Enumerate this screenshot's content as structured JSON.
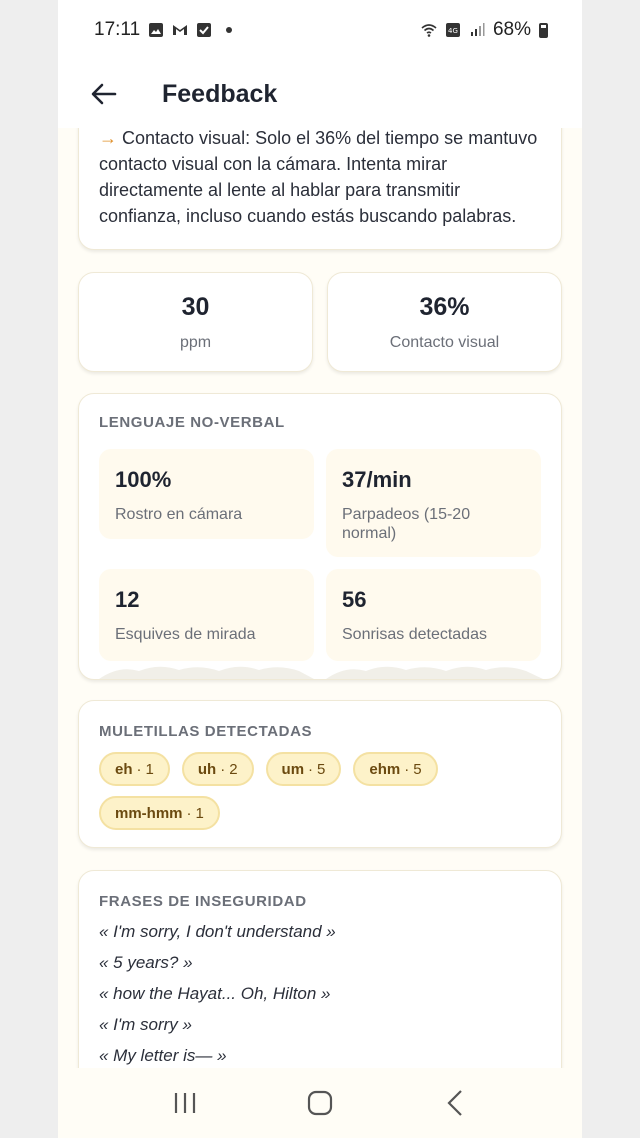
{
  "status_bar": {
    "time": "17:11",
    "battery": "68%",
    "icons": [
      "image-icon",
      "gmail-icon",
      "check-box-icon",
      "dot-icon",
      "wifi-icon",
      "volte-4g-icon",
      "signal-icon",
      "battery-icon"
    ]
  },
  "header": {
    "title": "Feedback",
    "back_icon": "arrow-left-icon"
  },
  "summary": {
    "arrow": "→",
    "text": " Contacto visual: Solo el 36% del tiempo se mantuvo contacto visual con la cámara. Intenta mirar directamente al lente al hablar para transmitir confianza, incluso cuando estás buscando palabras."
  },
  "stats": [
    {
      "value": "30",
      "label": "ppm"
    },
    {
      "value": "36%",
      "label": "Contacto visual"
    }
  ],
  "nonverbal": {
    "title": "LENGUAJE NO-VERBAL",
    "items": [
      {
        "value": "100%",
        "label": "Rostro en cámara"
      },
      {
        "value": "37/min",
        "label": "Parpadeos (15-20 normal)"
      },
      {
        "value": "12",
        "label": "Esquives de mirada"
      },
      {
        "value": "56",
        "label": "Sonrisas detectadas"
      }
    ]
  },
  "fillers": {
    "title": "MULETILLAS DETECTADAS",
    "items": [
      {
        "word": "eh",
        "count": "1"
      },
      {
        "word": "uh",
        "count": "2"
      },
      {
        "word": "um",
        "count": "5"
      },
      {
        "word": "ehm",
        "count": "5"
      },
      {
        "word": "mm-hmm",
        "count": "1"
      }
    ]
  },
  "insecurity": {
    "title": "FRASES DE INSEGURIDAD",
    "phrases": [
      "« I'm sorry, I don't understand »",
      "« 5 years? »",
      "« how the Hayat... Oh, Hilton »",
      "« I'm sorry »",
      "« My letter is— »"
    ]
  },
  "nav": {
    "icons": [
      "recent-apps-icon",
      "home-icon",
      "back-nav-icon"
    ]
  },
  "colors": {
    "accent": "#e0902a",
    "chip_bg": "#fdf2c9",
    "page_bg": "#fffdf6"
  }
}
